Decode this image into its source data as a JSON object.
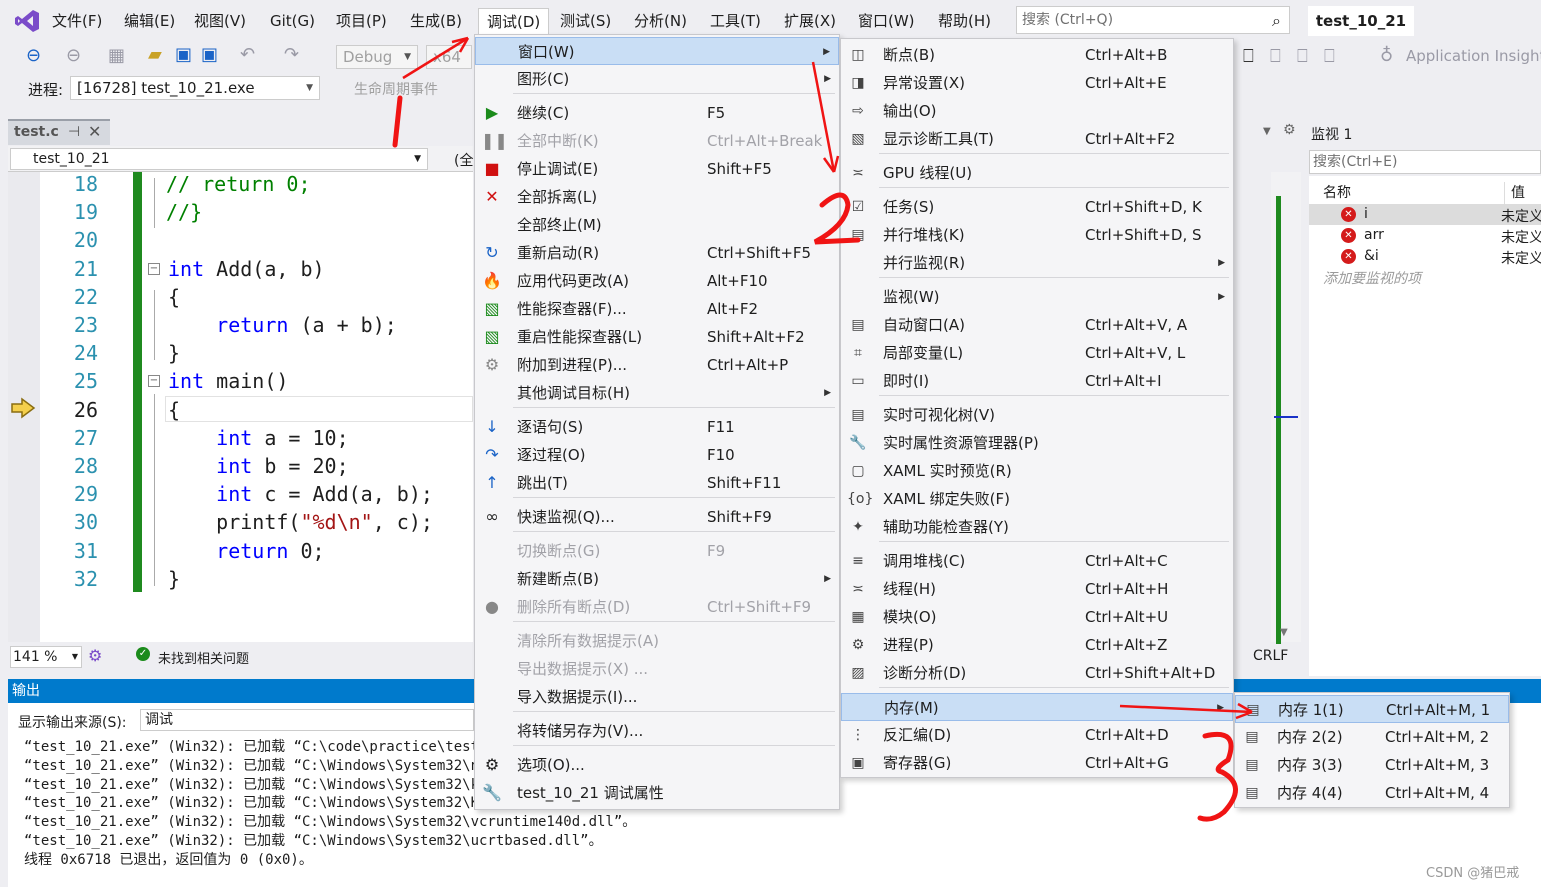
{
  "menubar": {
    "items": [
      "文件(F)",
      "编辑(E)",
      "视图(V)",
      "Git(G)",
      "项目(P)",
      "生成(B)",
      "调试(D)",
      "测试(S)",
      "分析(N)",
      "工具(T)",
      "扩展(X)",
      "窗口(W)",
      "帮助(H)"
    ],
    "search_placeholder": "搜索 (Ctrl+Q)",
    "solution": "test_10_21"
  },
  "toolbar": {
    "config": "Debug",
    "platform": "x64",
    "process_label": "进程:",
    "process_value": "[16728] test_10_21.exe",
    "lifecycle": "生命周期事件",
    "app_insights": "Application Insights"
  },
  "editor": {
    "tab": "test.c",
    "scope": "test_10_21",
    "scope2": "(全",
    "zoom": "141 %",
    "status": "未找到相关问题",
    "crlf": "CRLF",
    "line_numbers": [
      "18",
      "19",
      "20",
      "21",
      "22",
      "23",
      "24",
      "25",
      "26",
      "27",
      "28",
      "29",
      "30",
      "31",
      "32"
    ]
  },
  "output": {
    "title": "输出",
    "source_label": "显示输出来源(S):",
    "source_value": "调试",
    "lines": [
      "“test_10_21.exe” (Win32): 已加载 “C:\\code\\practice\\test_",
      "“test_10_21.exe” (Win32): 已加载 “C:\\Windows\\System32\\nt",
      "“test_10_21.exe” (Win32): 已加载 “C:\\Windows\\System32\\ke",
      "“test_10_21.exe” (Win32): 已加载 “C:\\Windows\\System32\\Ke",
      "“test_10_21.exe” (Win32): 已加载 “C:\\Windows\\System32\\vcruntime140d.dll”。",
      "“test_10_21.exe” (Win32): 已加载 “C:\\Windows\\System32\\ucrtbased.dll”。",
      "线程 0x6718 已退出，返回值为 0 (0x0)。"
    ]
  },
  "watch": {
    "title": "监视 1",
    "search": "搜索(Ctrl+E)",
    "col_name": "名称",
    "col_value": "值",
    "rows": [
      {
        "name": "i",
        "value": "未定义"
      },
      {
        "name": "arr",
        "value": "未定义"
      },
      {
        "name": "&i",
        "value": "未定义"
      }
    ],
    "add_hint": "添加要监视的项"
  },
  "debug_menu": [
    {
      "label": "窗口(W)",
      "sc": "",
      "arrow": true,
      "hl": true
    },
    {
      "label": "图形(C)",
      "sc": "",
      "arrow": true
    },
    {
      "label": "继续(C)",
      "sc": "F5",
      "icon": "play"
    },
    {
      "label": "全部中断(K)",
      "sc": "Ctrl+Alt+Break",
      "dis": true,
      "icon": "pause"
    },
    {
      "label": "停止调试(E)",
      "sc": "Shift+F5",
      "icon": "stop"
    },
    {
      "label": "全部拆离(L)",
      "sc": "",
      "icon": "detach"
    },
    {
      "label": "全部终止(M)",
      "sc": ""
    },
    {
      "label": "重新启动(R)",
      "sc": "Ctrl+Shift+F5",
      "icon": "restart"
    },
    {
      "label": "应用代码更改(A)",
      "sc": "Alt+F10",
      "icon": "hotreload"
    },
    {
      "label": "性能探查器(F)...",
      "sc": "Alt+F2",
      "icon": "perf"
    },
    {
      "label": "重启性能探查器(L)",
      "sc": "Shift+Alt+F2",
      "icon": "perf"
    },
    {
      "label": "附加到进程(P)...",
      "sc": "Ctrl+Alt+P",
      "icon": "gears"
    },
    {
      "label": "其他调试目标(H)",
      "sc": "",
      "arrow": true
    },
    {
      "label": "逐语句(S)",
      "sc": "F11",
      "icon": "stepinto"
    },
    {
      "label": "逐过程(O)",
      "sc": "F10",
      "icon": "stepover"
    },
    {
      "label": "跳出(T)",
      "sc": "Shift+F11",
      "icon": "stepout"
    },
    {
      "label": "快速监视(Q)...",
      "sc": "Shift+F9",
      "icon": "glasses"
    },
    {
      "label": "切换断点(G)",
      "sc": "F9",
      "dis": true
    },
    {
      "label": "新建断点(B)",
      "sc": "",
      "arrow": true
    },
    {
      "label": "删除所有断点(D)",
      "sc": "Ctrl+Shift+F9",
      "dis": true,
      "icon": "delbp"
    },
    {
      "label": "清除所有数据提示(A)",
      "sc": "",
      "dis": true
    },
    {
      "label": "导出数据提示(X) ...",
      "sc": "",
      "dis": true
    },
    {
      "label": "导入数据提示(I)...",
      "sc": ""
    },
    {
      "label": "将转储另存为(V)...",
      "sc": ""
    },
    {
      "label": "选项(O)...",
      "sc": "",
      "icon": "gear"
    },
    {
      "label": "test_10_21 调试属性",
      "sc": "",
      "icon": "wrench"
    }
  ],
  "window_menu": [
    {
      "label": "断点(B)",
      "sc": "Ctrl+Alt+B"
    },
    {
      "label": "异常设置(X)",
      "sc": "Ctrl+Alt+E"
    },
    {
      "label": "输出(O)",
      "sc": ""
    },
    {
      "label": "显示诊断工具(T)",
      "sc": "Ctrl+Alt+F2"
    },
    {
      "label": "GPU 线程(U)",
      "sc": ""
    },
    {
      "label": "任务(S)",
      "sc": "Ctrl+Shift+D, K"
    },
    {
      "label": "并行堆栈(K)",
      "sc": "Ctrl+Shift+D, S"
    },
    {
      "label": "并行监视(R)",
      "sc": "",
      "arrow": true
    },
    {
      "label": "监视(W)",
      "sc": "",
      "arrow": true
    },
    {
      "label": "自动窗口(A)",
      "sc": "Ctrl+Alt+V, A"
    },
    {
      "label": "局部变量(L)",
      "sc": "Ctrl+Alt+V, L"
    },
    {
      "label": "即时(I)",
      "sc": "Ctrl+Alt+I"
    },
    {
      "label": "实时可视化树(V)",
      "sc": ""
    },
    {
      "label": "实时属性资源管理器(P)",
      "sc": ""
    },
    {
      "label": "XAML 实时预览(R)",
      "sc": ""
    },
    {
      "label": "XAML 绑定失败(F)",
      "sc": ""
    },
    {
      "label": "辅助功能检查器(Y)",
      "sc": ""
    },
    {
      "label": "调用堆栈(C)",
      "sc": "Ctrl+Alt+C"
    },
    {
      "label": "线程(H)",
      "sc": "Ctrl+Alt+H"
    },
    {
      "label": "模块(O)",
      "sc": "Ctrl+Alt+U"
    },
    {
      "label": "进程(P)",
      "sc": "Ctrl+Alt+Z"
    },
    {
      "label": "诊断分析(D)",
      "sc": "Ctrl+Shift+Alt+D"
    },
    {
      "label": "内存(M)",
      "sc": "",
      "arrow": true,
      "hl": true
    },
    {
      "label": "反汇编(D)",
      "sc": "Ctrl+Alt+D"
    },
    {
      "label": "寄存器(G)",
      "sc": "Ctrl+Alt+G"
    }
  ],
  "memory_menu": [
    {
      "label": "内存 1(1)",
      "sc": "Ctrl+Alt+M, 1",
      "hl": true
    },
    {
      "label": "内存 2(2)",
      "sc": "Ctrl+Alt+M, 2"
    },
    {
      "label": "内存 3(3)",
      "sc": "Ctrl+Alt+M, 3"
    },
    {
      "label": "内存 4(4)",
      "sc": "Ctrl+Alt+M, 4"
    }
  ],
  "annotations": [
    "1",
    "2",
    "3"
  ],
  "watermark": "CSDN @猪巴戒"
}
